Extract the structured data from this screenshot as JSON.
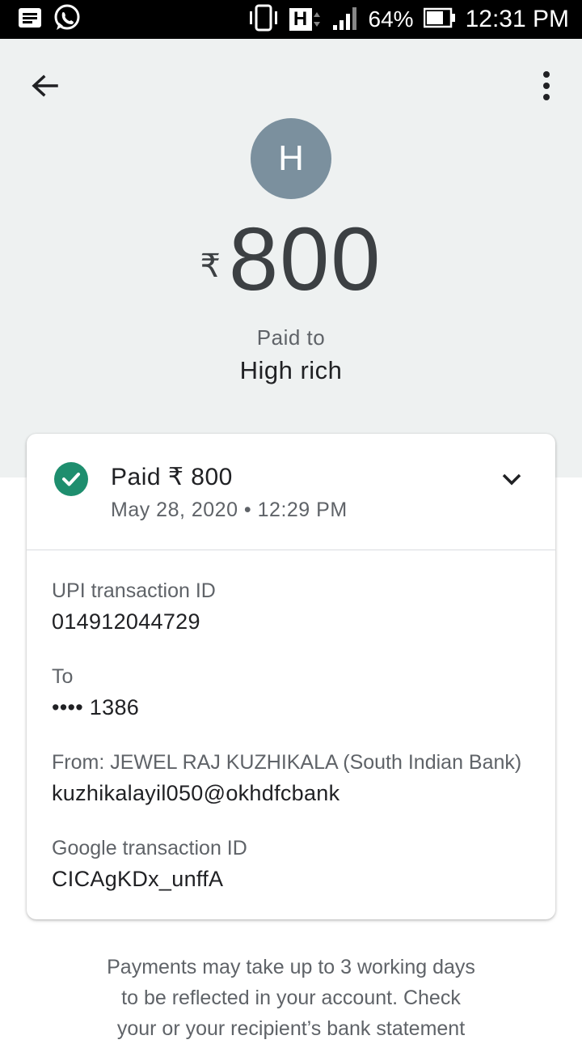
{
  "status_bar": {
    "battery_percent": "64%",
    "time": "12:31 PM",
    "network_label": "H",
    "icons": [
      "message-icon",
      "whatsapp-icon",
      "vibrate-icon",
      "network-h-icon",
      "signal-icon",
      "battery-icon"
    ]
  },
  "header": {
    "avatar_initial": "H",
    "currency_symbol": "₹",
    "amount": "800",
    "paid_to_label": "Paid to",
    "payee_name": "High rich",
    "bg_color": "#eef1f1",
    "avatar_color": "#7b909e"
  },
  "card": {
    "status_title": "Paid ₹ 800",
    "status_datetime": "May 28, 2020 • 12:29 PM",
    "status_color": "#1e8e6e",
    "fields": [
      {
        "label": "UPI transaction ID",
        "value": "014912044729"
      },
      {
        "label": "To",
        "value": "•••• 1386"
      },
      {
        "label": "From: JEWEL RAJ KUZHIKALA (South Indian Bank)",
        "value": "kuzhikalayil050@okhdfcbank"
      },
      {
        "label": "Google transaction ID",
        "value": "CICAgKDx_unffA"
      }
    ]
  },
  "footer": {
    "lines": [
      "Payments may take up to 3 working days",
      "to be reflected in your account. Check",
      "your or your recipient’s bank statement"
    ]
  }
}
